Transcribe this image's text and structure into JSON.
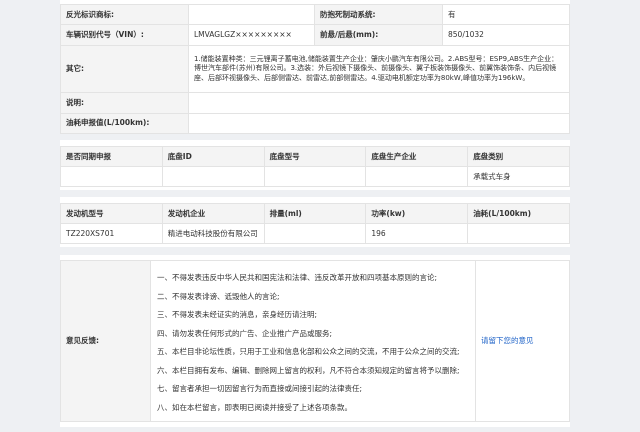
{
  "spec": {
    "rows": [
      {
        "label": "反光标识商标:",
        "value": "",
        "label2": "防抱死制动系统:",
        "value2": "有"
      },
      {
        "label": "车辆识别代号（VIN）:",
        "value": "LMVAGLGZ×××××××××",
        "label2": "前悬/后悬(mm):",
        "value2": "850/1032"
      },
      {
        "label": "其它:",
        "value": "1.储能装置种类：三元锂离子蓄电池,储能装置生产企业：肇庆小鹏汽车有限公司。2.ABS型号：ESP9,ABS生产企业：博世汽车部件(苏州)有限公司。3.选装：外后视镜下摄像头、前摄像头、翼子板装饰摄像头、前翼饰装饰条、内后视镜座、后部环视摄像头、后部侧雷达、前雷达,前部侧雷达。4.驱动电机额定功率为80kW,峰值功率为196kW。"
      },
      {
        "label": "说明:",
        "value": ""
      },
      {
        "label": "油耗申报值(L/100km):",
        "value": ""
      }
    ]
  },
  "chassis": {
    "headers": [
      "是否同期申报",
      "底盘ID",
      "底盘型号",
      "底盘生产企业",
      "底盘类别"
    ],
    "row": [
      "",
      "",
      "",
      "",
      "承载式车身"
    ]
  },
  "engine": {
    "headers": [
      "发动机型号",
      "发动机企业",
      "排量(ml)",
      "功率(kw)",
      "油耗(L/100km)"
    ],
    "row": [
      "TZ220XS701",
      "精进电动科技股份有限公司",
      "",
      "196",
      ""
    ]
  },
  "feedback": {
    "label": "意见反馈:",
    "rules": [
      "一、不得发表违反中华人民共和国宪法和法律、违反改革开放和四项基本原则的言论;",
      "二、不得发表诽谤、诋毁他人的言论;",
      "三、不得发表未经证实的消息，亲身经历请注明;",
      "四、请勿发表任何形式的广告、企业推广产品或服务;",
      "五、本栏目非论坛性质，只用于工业和信息化部和公众之间的交流，不用于公众之间的交流;",
      "六、本栏目拥有发布、编辑、删除网上留言的权利，凡不符合本须知规定的留言将予以删除;",
      "七、留言者承担一切因留言行为而直接或间接引起的法律责任;",
      "八、如在本栏留言，即表明已阅读并接受了上述各项条款。"
    ],
    "link": "请留下您的意见"
  }
}
